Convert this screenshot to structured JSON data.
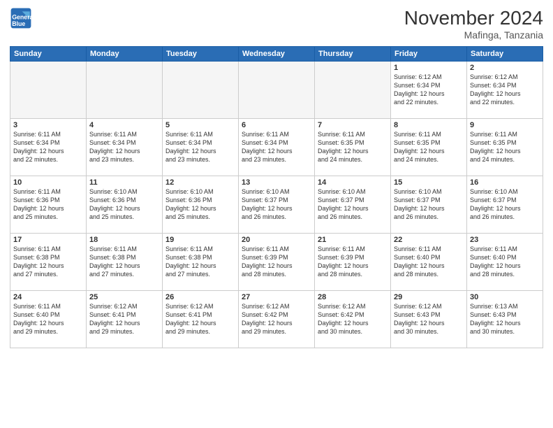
{
  "header": {
    "logo_line1": "General",
    "logo_line2": "Blue",
    "month": "November 2024",
    "location": "Mafinga, Tanzania"
  },
  "weekdays": [
    "Sunday",
    "Monday",
    "Tuesday",
    "Wednesday",
    "Thursday",
    "Friday",
    "Saturday"
  ],
  "weeks": [
    [
      {
        "day": "",
        "info": ""
      },
      {
        "day": "",
        "info": ""
      },
      {
        "day": "",
        "info": ""
      },
      {
        "day": "",
        "info": ""
      },
      {
        "day": "",
        "info": ""
      },
      {
        "day": "1",
        "info": "Sunrise: 6:12 AM\nSunset: 6:34 PM\nDaylight: 12 hours\nand 22 minutes."
      },
      {
        "day": "2",
        "info": "Sunrise: 6:12 AM\nSunset: 6:34 PM\nDaylight: 12 hours\nand 22 minutes."
      }
    ],
    [
      {
        "day": "3",
        "info": "Sunrise: 6:11 AM\nSunset: 6:34 PM\nDaylight: 12 hours\nand 22 minutes."
      },
      {
        "day": "4",
        "info": "Sunrise: 6:11 AM\nSunset: 6:34 PM\nDaylight: 12 hours\nand 23 minutes."
      },
      {
        "day": "5",
        "info": "Sunrise: 6:11 AM\nSunset: 6:34 PM\nDaylight: 12 hours\nand 23 minutes."
      },
      {
        "day": "6",
        "info": "Sunrise: 6:11 AM\nSunset: 6:34 PM\nDaylight: 12 hours\nand 23 minutes."
      },
      {
        "day": "7",
        "info": "Sunrise: 6:11 AM\nSunset: 6:35 PM\nDaylight: 12 hours\nand 24 minutes."
      },
      {
        "day": "8",
        "info": "Sunrise: 6:11 AM\nSunset: 6:35 PM\nDaylight: 12 hours\nand 24 minutes."
      },
      {
        "day": "9",
        "info": "Sunrise: 6:11 AM\nSunset: 6:35 PM\nDaylight: 12 hours\nand 24 minutes."
      }
    ],
    [
      {
        "day": "10",
        "info": "Sunrise: 6:11 AM\nSunset: 6:36 PM\nDaylight: 12 hours\nand 25 minutes."
      },
      {
        "day": "11",
        "info": "Sunrise: 6:10 AM\nSunset: 6:36 PM\nDaylight: 12 hours\nand 25 minutes."
      },
      {
        "day": "12",
        "info": "Sunrise: 6:10 AM\nSunset: 6:36 PM\nDaylight: 12 hours\nand 25 minutes."
      },
      {
        "day": "13",
        "info": "Sunrise: 6:10 AM\nSunset: 6:37 PM\nDaylight: 12 hours\nand 26 minutes."
      },
      {
        "day": "14",
        "info": "Sunrise: 6:10 AM\nSunset: 6:37 PM\nDaylight: 12 hours\nand 26 minutes."
      },
      {
        "day": "15",
        "info": "Sunrise: 6:10 AM\nSunset: 6:37 PM\nDaylight: 12 hours\nand 26 minutes."
      },
      {
        "day": "16",
        "info": "Sunrise: 6:10 AM\nSunset: 6:37 PM\nDaylight: 12 hours\nand 26 minutes."
      }
    ],
    [
      {
        "day": "17",
        "info": "Sunrise: 6:11 AM\nSunset: 6:38 PM\nDaylight: 12 hours\nand 27 minutes."
      },
      {
        "day": "18",
        "info": "Sunrise: 6:11 AM\nSunset: 6:38 PM\nDaylight: 12 hours\nand 27 minutes."
      },
      {
        "day": "19",
        "info": "Sunrise: 6:11 AM\nSunset: 6:38 PM\nDaylight: 12 hours\nand 27 minutes."
      },
      {
        "day": "20",
        "info": "Sunrise: 6:11 AM\nSunset: 6:39 PM\nDaylight: 12 hours\nand 28 minutes."
      },
      {
        "day": "21",
        "info": "Sunrise: 6:11 AM\nSunset: 6:39 PM\nDaylight: 12 hours\nand 28 minutes."
      },
      {
        "day": "22",
        "info": "Sunrise: 6:11 AM\nSunset: 6:40 PM\nDaylight: 12 hours\nand 28 minutes."
      },
      {
        "day": "23",
        "info": "Sunrise: 6:11 AM\nSunset: 6:40 PM\nDaylight: 12 hours\nand 28 minutes."
      }
    ],
    [
      {
        "day": "24",
        "info": "Sunrise: 6:11 AM\nSunset: 6:40 PM\nDaylight: 12 hours\nand 29 minutes."
      },
      {
        "day": "25",
        "info": "Sunrise: 6:12 AM\nSunset: 6:41 PM\nDaylight: 12 hours\nand 29 minutes."
      },
      {
        "day": "26",
        "info": "Sunrise: 6:12 AM\nSunset: 6:41 PM\nDaylight: 12 hours\nand 29 minutes."
      },
      {
        "day": "27",
        "info": "Sunrise: 6:12 AM\nSunset: 6:42 PM\nDaylight: 12 hours\nand 29 minutes."
      },
      {
        "day": "28",
        "info": "Sunrise: 6:12 AM\nSunset: 6:42 PM\nDaylight: 12 hours\nand 30 minutes."
      },
      {
        "day": "29",
        "info": "Sunrise: 6:12 AM\nSunset: 6:43 PM\nDaylight: 12 hours\nand 30 minutes."
      },
      {
        "day": "30",
        "info": "Sunrise: 6:13 AM\nSunset: 6:43 PM\nDaylight: 12 hours\nand 30 minutes."
      }
    ]
  ]
}
